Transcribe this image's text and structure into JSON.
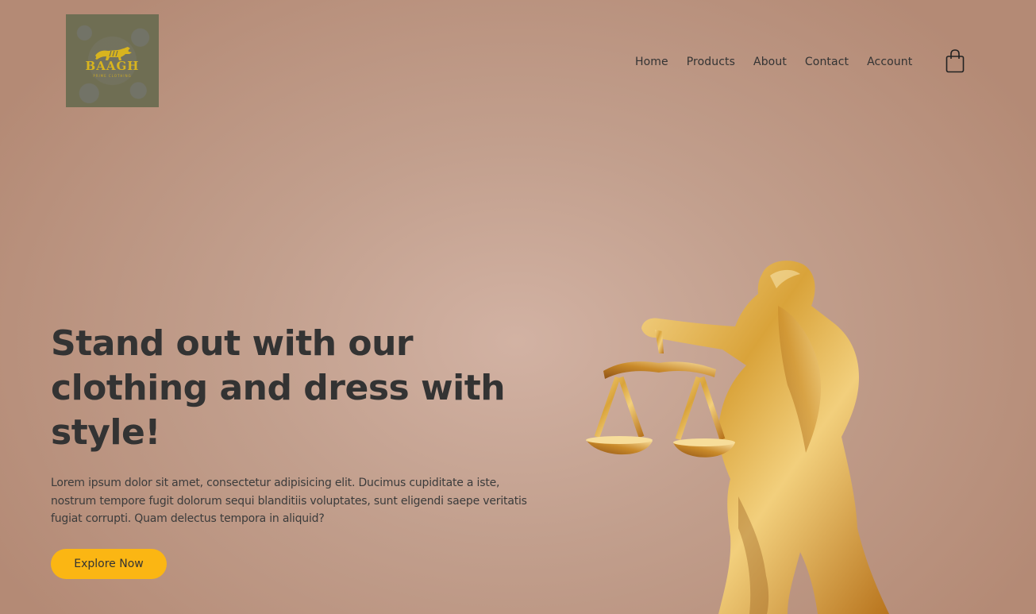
{
  "brand": {
    "logo_text": "BAAGH",
    "logo_sub": "PRIME CLOTHING",
    "logo_icon": "tiger-icon"
  },
  "nav": {
    "items": [
      "Home",
      "Products",
      "About",
      "Contact",
      "Account"
    ],
    "cart_icon": "shopping-bag-icon"
  },
  "hero": {
    "title": "Stand out with our clothing and dress with style!",
    "description": "Lorem ipsum dolor sit amet, consectetur adipisicing elit. Ducimus cupiditate a iste, nostrum tempore fugit dolorum sequi blanditiis voluptates, sunt eligendi saepe veritatis fugiat corrupti. Quam delectus tempora in aliquid?",
    "cta_label": "Explore Now"
  },
  "colors": {
    "accent": "#fbb613",
    "background": "#c29f8d",
    "text": "#333333",
    "logo_gold": "#d8b41e"
  },
  "image": {
    "icon": "libra-scales-statue"
  }
}
